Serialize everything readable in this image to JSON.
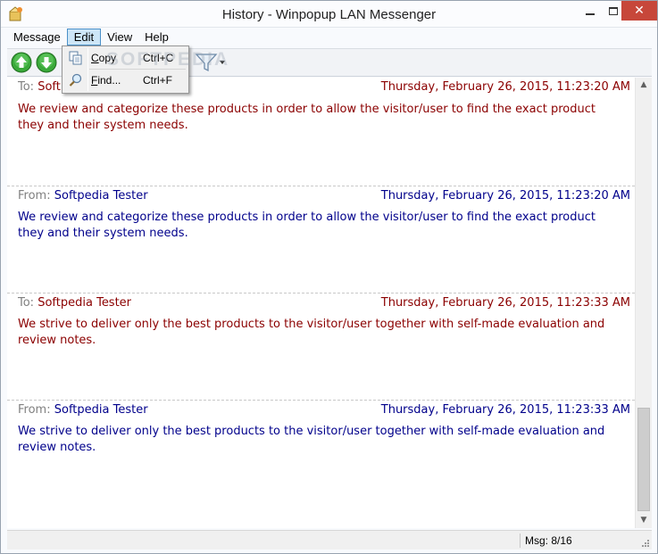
{
  "window": {
    "title": "History - Winpopup LAN Messenger"
  },
  "menu": {
    "items": [
      {
        "label": "Message"
      },
      {
        "label": "Edit"
      },
      {
        "label": "View"
      },
      {
        "label": "Help"
      }
    ],
    "active": "Edit"
  },
  "edit_menu": {
    "items": [
      {
        "label_prefix": "C",
        "label_rest": "opy",
        "shortcut": "Ctrl+C",
        "icon": "copy-icon"
      },
      {
        "label_prefix": "F",
        "label_rest": "ind...",
        "shortcut": "Ctrl+F",
        "icon": "find-icon"
      }
    ]
  },
  "toolbar": {
    "buttons": [
      {
        "icon": "arrow-up-icon"
      },
      {
        "icon": "arrow-down-icon"
      },
      {
        "icon": "filter-icon"
      }
    ]
  },
  "watermark": "SOFTPEDIA",
  "messages": [
    {
      "direction": "to",
      "prefix": "To:",
      "name": "Softpedia Tester",
      "name_visible": "Soft",
      "date": "Thursday, February 26, 2015, 11:23:20 AM",
      "text": "We review and categorize these products in order to allow the visitor/user to find the exact product they and their system needs."
    },
    {
      "direction": "from",
      "prefix": "From:",
      "name": "Softpedia Tester",
      "date": "Thursday, February 26, 2015, 11:23:20 AM",
      "text": "We review and categorize these products in order to allow the visitor/user to find the exact product they and their system needs."
    },
    {
      "direction": "to",
      "prefix": "To:",
      "name": "Softpedia Tester",
      "date": "Thursday, February 26, 2015, 11:23:33 AM",
      "text": "We strive to deliver only the best products to the visitor/user together with self-made evaluation and review notes."
    },
    {
      "direction": "from",
      "prefix": "From:",
      "name": "Softpedia Tester",
      "date": "Thursday, February 26, 2015, 11:23:33 AM",
      "text": "We strive to deliver only the best products to the visitor/user together with self-made evaluation and review notes."
    }
  ],
  "status": {
    "text": "Msg: 8/16"
  },
  "colors": {
    "to": "#8b0000",
    "from": "#00008b",
    "accent": "#4a90c8",
    "close": "#c7473a"
  }
}
